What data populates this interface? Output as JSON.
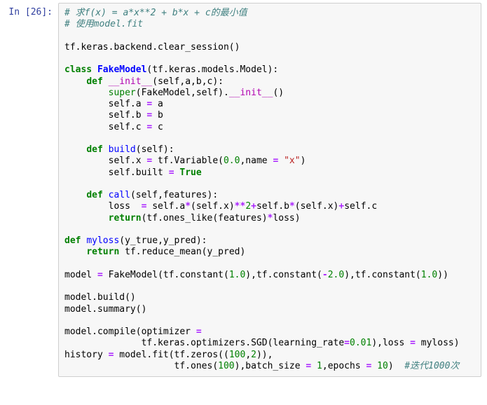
{
  "cell": {
    "prompt_prefix": "In [",
    "exec_count": "26",
    "prompt_suffix": "]:",
    "lines": [
      [
        {
          "t": "# 求f(x) = a*x**2 + b*x + c的最小值",
          "c": "c-comment"
        }
      ],
      [
        {
          "t": "# 使用model.fit",
          "c": "c-comment"
        }
      ],
      [
        {
          "t": ""
        }
      ],
      [
        {
          "t": "tf.keras.backend.clear_session()"
        }
      ],
      [
        {
          "t": ""
        }
      ],
      [
        {
          "t": "class",
          "c": "c-keyword"
        },
        {
          "t": " "
        },
        {
          "t": "FakeModel",
          "c": "c-classname"
        },
        {
          "t": "(tf.keras.models.Model):"
        }
      ],
      [
        {
          "t": "    "
        },
        {
          "t": "def",
          "c": "c-keyword"
        },
        {
          "t": " "
        },
        {
          "t": "__init__",
          "c": "c-magic"
        },
        {
          "t": "(self,a,b,c):"
        }
      ],
      [
        {
          "t": "        "
        },
        {
          "t": "super",
          "c": "c-builtin"
        },
        {
          "t": "(FakeModel,self)."
        },
        {
          "t": "__init__",
          "c": "c-magic"
        },
        {
          "t": "()"
        }
      ],
      [
        {
          "t": "        self.a "
        },
        {
          "t": "=",
          "c": "c-op"
        },
        {
          "t": " a"
        }
      ],
      [
        {
          "t": "        self.b "
        },
        {
          "t": "=",
          "c": "c-op"
        },
        {
          "t": " b"
        }
      ],
      [
        {
          "t": "        self.c "
        },
        {
          "t": "=",
          "c": "c-op"
        },
        {
          "t": " c"
        }
      ],
      [
        {
          "t": ""
        }
      ],
      [
        {
          "t": "    "
        },
        {
          "t": "def",
          "c": "c-keyword"
        },
        {
          "t": " "
        },
        {
          "t": "build",
          "c": "c-funcname"
        },
        {
          "t": "(self):"
        }
      ],
      [
        {
          "t": "        self.x "
        },
        {
          "t": "=",
          "c": "c-op"
        },
        {
          "t": " tf.Variable("
        },
        {
          "t": "0.0",
          "c": "c-num"
        },
        {
          "t": ",name "
        },
        {
          "t": "=",
          "c": "c-op"
        },
        {
          "t": " "
        },
        {
          "t": "\"x\"",
          "c": "c-str"
        },
        {
          "t": ")"
        }
      ],
      [
        {
          "t": "        self.built "
        },
        {
          "t": "=",
          "c": "c-op"
        },
        {
          "t": " "
        },
        {
          "t": "True",
          "c": "c-boolnone"
        }
      ],
      [
        {
          "t": ""
        }
      ],
      [
        {
          "t": "    "
        },
        {
          "t": "def",
          "c": "c-keyword"
        },
        {
          "t": " "
        },
        {
          "t": "call",
          "c": "c-funcname"
        },
        {
          "t": "(self,features):"
        }
      ],
      [
        {
          "t": "        loss  "
        },
        {
          "t": "=",
          "c": "c-op"
        },
        {
          "t": " self.a"
        },
        {
          "t": "*",
          "c": "c-op"
        },
        {
          "t": "(self.x)"
        },
        {
          "t": "**",
          "c": "c-op"
        },
        {
          "t": "2",
          "c": "c-num"
        },
        {
          "t": "+",
          "c": "c-op"
        },
        {
          "t": "self.b"
        },
        {
          "t": "*",
          "c": "c-op"
        },
        {
          "t": "(self.x)"
        },
        {
          "t": "+",
          "c": "c-op"
        },
        {
          "t": "self.c"
        }
      ],
      [
        {
          "t": "        "
        },
        {
          "t": "return",
          "c": "c-keyword"
        },
        {
          "t": "(tf.ones_like(features)"
        },
        {
          "t": "*",
          "c": "c-op"
        },
        {
          "t": "loss)"
        }
      ],
      [
        {
          "t": ""
        }
      ],
      [
        {
          "t": "def",
          "c": "c-keyword"
        },
        {
          "t": " "
        },
        {
          "t": "myloss",
          "c": "c-funcname"
        },
        {
          "t": "(y_true,y_pred):"
        }
      ],
      [
        {
          "t": "    "
        },
        {
          "t": "return",
          "c": "c-keyword"
        },
        {
          "t": " tf.reduce_mean(y_pred)"
        }
      ],
      [
        {
          "t": ""
        }
      ],
      [
        {
          "t": "model "
        },
        {
          "t": "=",
          "c": "c-op"
        },
        {
          "t": " FakeModel(tf.constant("
        },
        {
          "t": "1.0",
          "c": "c-num"
        },
        {
          "t": "),tf.constant("
        },
        {
          "t": "-",
          "c": "c-op"
        },
        {
          "t": "2.0",
          "c": "c-num"
        },
        {
          "t": "),tf.constant("
        },
        {
          "t": "1.0",
          "c": "c-num"
        },
        {
          "t": "))"
        }
      ],
      [
        {
          "t": ""
        }
      ],
      [
        {
          "t": "model.build()"
        }
      ],
      [
        {
          "t": "model.summary()"
        }
      ],
      [
        {
          "t": ""
        }
      ],
      [
        {
          "t": "model.compile(optimizer "
        },
        {
          "t": "=",
          "c": "c-op"
        },
        {
          "t": " "
        }
      ],
      [
        {
          "t": "              tf.keras.optimizers.SGD(learning_rate"
        },
        {
          "t": "=",
          "c": "c-op"
        },
        {
          "t": "0.01",
          "c": "c-num"
        },
        {
          "t": "),loss "
        },
        {
          "t": "=",
          "c": "c-op"
        },
        {
          "t": " myloss)"
        }
      ],
      [
        {
          "t": "history "
        },
        {
          "t": "=",
          "c": "c-op"
        },
        {
          "t": " model.fit(tf.zeros(("
        },
        {
          "t": "100",
          "c": "c-num"
        },
        {
          "t": ","
        },
        {
          "t": "2",
          "c": "c-num"
        },
        {
          "t": ")),"
        }
      ],
      [
        {
          "t": "                    tf.ones("
        },
        {
          "t": "100",
          "c": "c-num"
        },
        {
          "t": "),batch_size "
        },
        {
          "t": "=",
          "c": "c-op"
        },
        {
          "t": " "
        },
        {
          "t": "1",
          "c": "c-num"
        },
        {
          "t": ",epochs "
        },
        {
          "t": "=",
          "c": "c-op"
        },
        {
          "t": " "
        },
        {
          "t": "10",
          "c": "c-num"
        },
        {
          "t": ")  "
        },
        {
          "t": "#迭代1000次",
          "c": "c-comment"
        }
      ]
    ]
  }
}
